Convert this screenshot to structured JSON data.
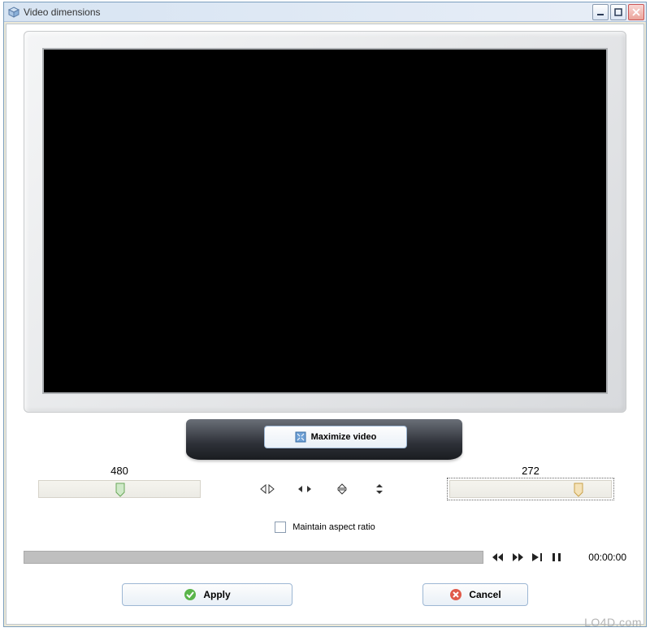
{
  "window": {
    "title": "Video dimensions"
  },
  "buttons": {
    "maximize": "Maximize video",
    "apply": "Apply",
    "cancel": "Cancel"
  },
  "dimensions": {
    "width": "480",
    "height": "272",
    "slider_width_pos": 0.48,
    "slider_height_pos": 0.78
  },
  "aspect": {
    "label": "Maintain aspect ratio",
    "checked": false
  },
  "playback": {
    "timecode": "00:00:00"
  },
  "watermark": "LO4D.com",
  "icons": {
    "app": "cube-icon",
    "maximize_btn": "expand-icon",
    "apply_btn": "ok-icon",
    "cancel_btn": "cancel-icon"
  }
}
